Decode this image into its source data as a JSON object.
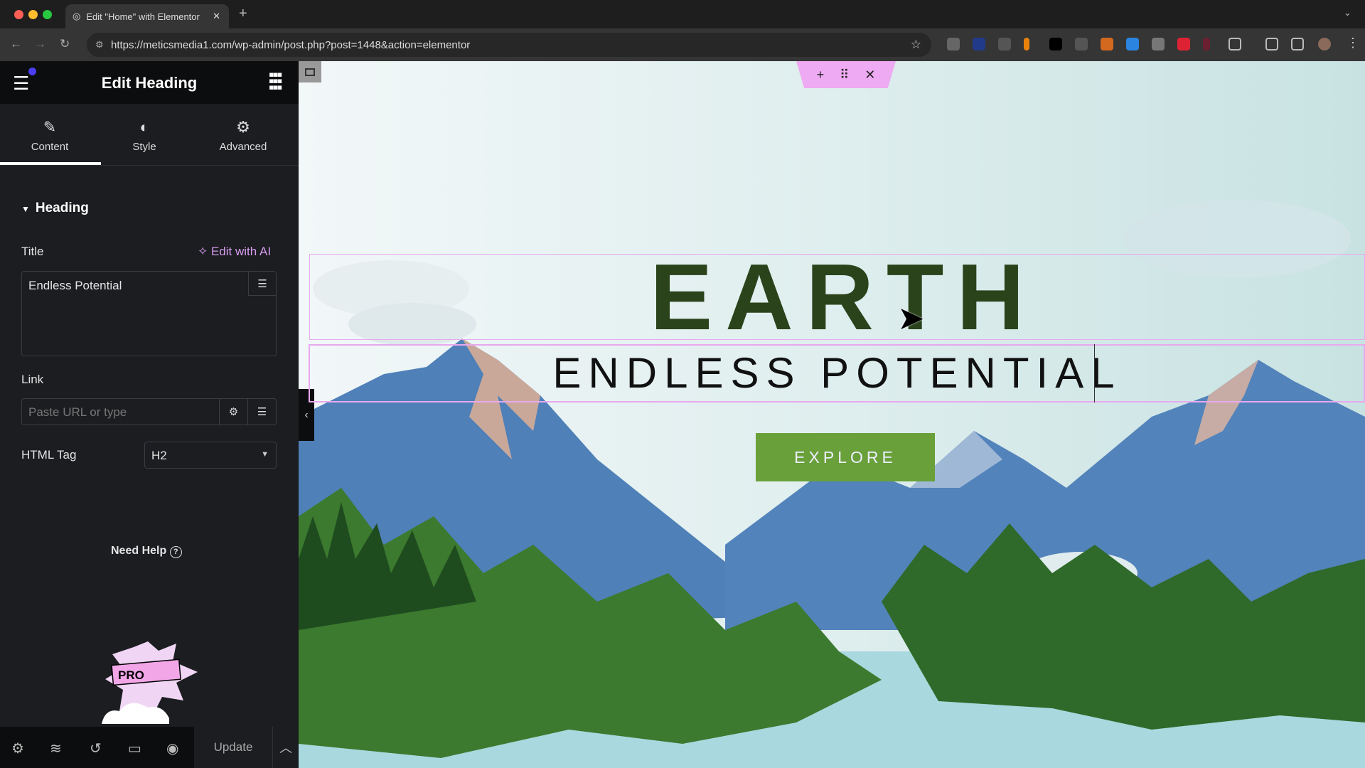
{
  "browser": {
    "tab_title": "Edit \"Home\" with Elementor",
    "url": "https://meticsmedia1.com/wp-admin/post.php?post=1448&action=elementor"
  },
  "sidebar": {
    "title": "Edit Heading",
    "tabs": [
      {
        "label": "Content",
        "icon": "pencil-icon",
        "active": true
      },
      {
        "label": "Style",
        "icon": "contrast-icon"
      },
      {
        "label": "Advanced",
        "icon": "gear-icon"
      }
    ],
    "section": "Heading",
    "title_label": "Title",
    "edit_ai": "Edit with AI",
    "title_value": "Endless Potential",
    "link_label": "Link",
    "link_placeholder": "Paste URL or type",
    "html_tag_label": "HTML Tag",
    "html_tag_value": "H2",
    "need_help": "Need Help",
    "pro_badge": "PRO",
    "update": "Update"
  },
  "canvas": {
    "heading": "EARTH",
    "subheading": "ENDLESS POTENTIAL",
    "button": "EXPLORE"
  },
  "colors": {
    "accent": "#e8a8ee",
    "button": "#69a03a",
    "heading": "#2a431b",
    "ai": "#d89cf0"
  }
}
